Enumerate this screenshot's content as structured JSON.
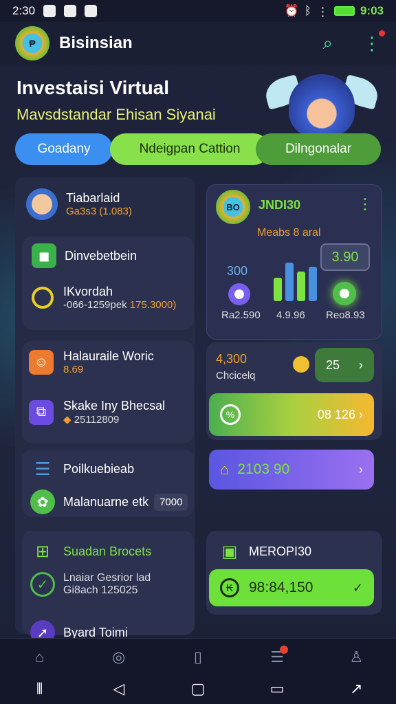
{
  "status_bar": {
    "time_left": "2:30",
    "time_right": "9:03"
  },
  "app_bar": {
    "title": "Bisinsian",
    "logo_text": "₱"
  },
  "hero": {
    "title": "Investaisi Virtual",
    "subtitle": "Mavsdstandar Ehisan Siyanai"
  },
  "tabs": [
    {
      "label": "Goadany"
    },
    {
      "label": "Ndeigpan Cattion"
    },
    {
      "label": "Dilngonalar"
    }
  ],
  "profile": {
    "name": "Tiabarlaid",
    "detail": "Ga3s3 (1.083)"
  },
  "invest": {
    "title": "Dinvebetbein",
    "sub_title": "IKvordah",
    "sub_detail": "-066-1259pek",
    "sub_value": "175.3000)"
  },
  "stats_card": {
    "avatar_text": "BO",
    "title": "JNDI30",
    "subtitle": "Meabs 8 aral",
    "badge": "3.90",
    "left_value": "300",
    "left_caption": "Ra2.590",
    "mid_caption": "4.9.96",
    "right_caption": "Reo8.93",
    "bars": [
      0.55,
      0.9,
      0.7,
      0.8
    ]
  },
  "work": {
    "title": "Halauraile Woric",
    "value": "8.69"
  },
  "stake": {
    "title": "Skake Iny Bhecsal",
    "value": "25112809"
  },
  "mid_card": {
    "amount": "4,300",
    "caption": "Chcicelq",
    "btn": "25",
    "gradient_value": "08 126"
  },
  "policy": {
    "title": "Poilkuebieab",
    "sub": "Malanuarne etk",
    "chip": "7000"
  },
  "purple_btn": {
    "value": "2103 90"
  },
  "bottom_left": {
    "title": "Suadan Brocets",
    "line1": "Lnaiar Gesrior lad",
    "line2": "Gi8ach 125025",
    "line3": "Byard Toimi"
  },
  "bottom_right": {
    "title": "MEROPI30",
    "value": "98:84,150"
  },
  "colors": {
    "accent_green": "#7de340",
    "accent_blue": "#3a8ff0",
    "accent_purple": "#8a6cf0",
    "accent_orange": "#f0a030"
  }
}
